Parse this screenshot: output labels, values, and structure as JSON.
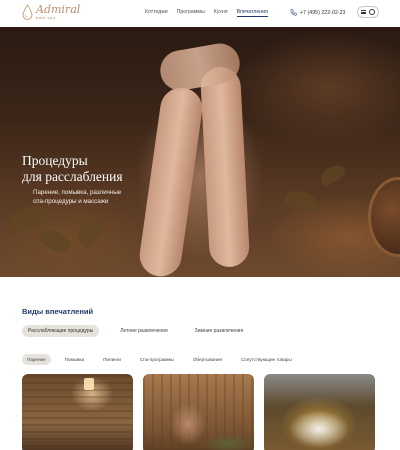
{
  "header": {
    "logo_name": "Admiral",
    "logo_sub": "bath spa",
    "nav": [
      "Коттеджи",
      "Программы",
      "Кухня",
      "Впечатления"
    ],
    "nav_active_index": 3,
    "phone": "+7 (495) 222-02-23",
    "icons": [
      "phone-icon",
      "menu-icon",
      "user-icon"
    ]
  },
  "hero": {
    "title_line1": "Процедуры",
    "title_line2": "для расслабления",
    "desc_line1": "Парение, помывка, различные",
    "desc_line2": "спа-процедуры и массажи"
  },
  "section": {
    "title": "Виды впечатлений",
    "tabs_primary": [
      "Расслабляющие процедуры",
      "Летние развлечения",
      "Зимние развлечения"
    ],
    "tabs_primary_active": 0,
    "tabs_secondary": [
      "Парение",
      "Помывка",
      "Пилинги",
      "Спа-программы",
      "Обертывания",
      "Сопутствующие товары"
    ],
    "tabs_secondary_active": 0
  },
  "colors": {
    "accent_blue": "#1f3b6e",
    "logo_gold": "#b98f6a",
    "tab_active_bg": "#e6e2dc"
  }
}
